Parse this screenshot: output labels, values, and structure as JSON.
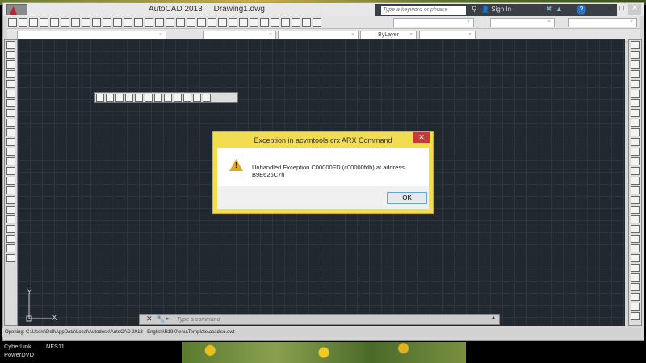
{
  "window": {
    "app": "AutoCAD 2013",
    "file": "Drawing1.dwg"
  },
  "search": {
    "placeholder": "Type a keyword or phrase"
  },
  "account": {
    "sign_in": "Sign In"
  },
  "toolbar": {
    "layer_value": "ByLayer"
  },
  "dialog": {
    "title": "Exception in acvmtools.crx ARX Command",
    "message": "Unhandled Exception C00000FD (c00000fdh) at address B9E626C7h",
    "ok_label": "OK",
    "close_label": "✕"
  },
  "command": {
    "placeholder": "Type a command"
  },
  "status": {
    "text": "Opening: C:\\Users\\Dell\\AppData\\Local\\Autodesk\\AutoCAD 2013 - English\\R19.0\\enu\\Template\\acadiso.dwt"
  },
  "ucs": {
    "x": "X",
    "y": "Y"
  },
  "desktop": {
    "icon1": "CyberLink\nPowerDVD",
    "icon2": "NFS11"
  }
}
